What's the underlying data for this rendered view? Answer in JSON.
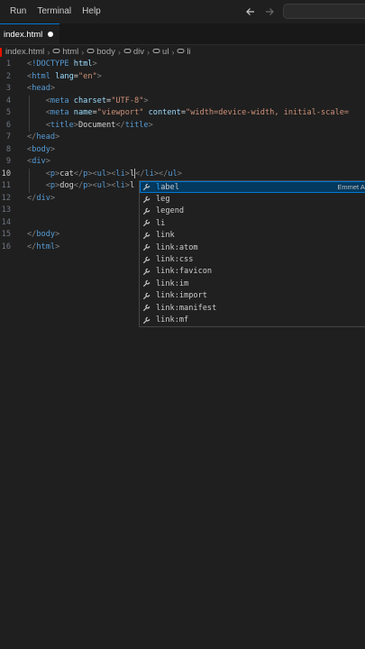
{
  "menu": {
    "items": [
      "Run",
      "Terminal",
      "Help"
    ]
  },
  "tab": {
    "label": "index.html"
  },
  "breadcrumb": {
    "items": [
      "index.html",
      "html",
      "body",
      "div",
      "ul",
      "li"
    ]
  },
  "editor": {
    "line_numbers": [
      "1",
      "2",
      "3",
      "4",
      "5",
      "6",
      "7",
      "8",
      "9",
      "10",
      "11",
      "12",
      "13",
      "14",
      "15",
      "16"
    ],
    "active_line": "10"
  },
  "suggest": {
    "selected_detail": "Emmet Ab",
    "items": [
      "label",
      "leg",
      "legend",
      "li",
      "link",
      "link:atom",
      "link:css",
      "link:favicon",
      "link:im",
      "link:import",
      "link:manifest",
      "link:mf"
    ]
  },
  "colors": {
    "accent": "#0078d4",
    "background": "#1f1f1f",
    "tag": "#569cd6",
    "attr": "#9cdcfe",
    "string": "#ce9178",
    "match": "#2aaaff"
  }
}
